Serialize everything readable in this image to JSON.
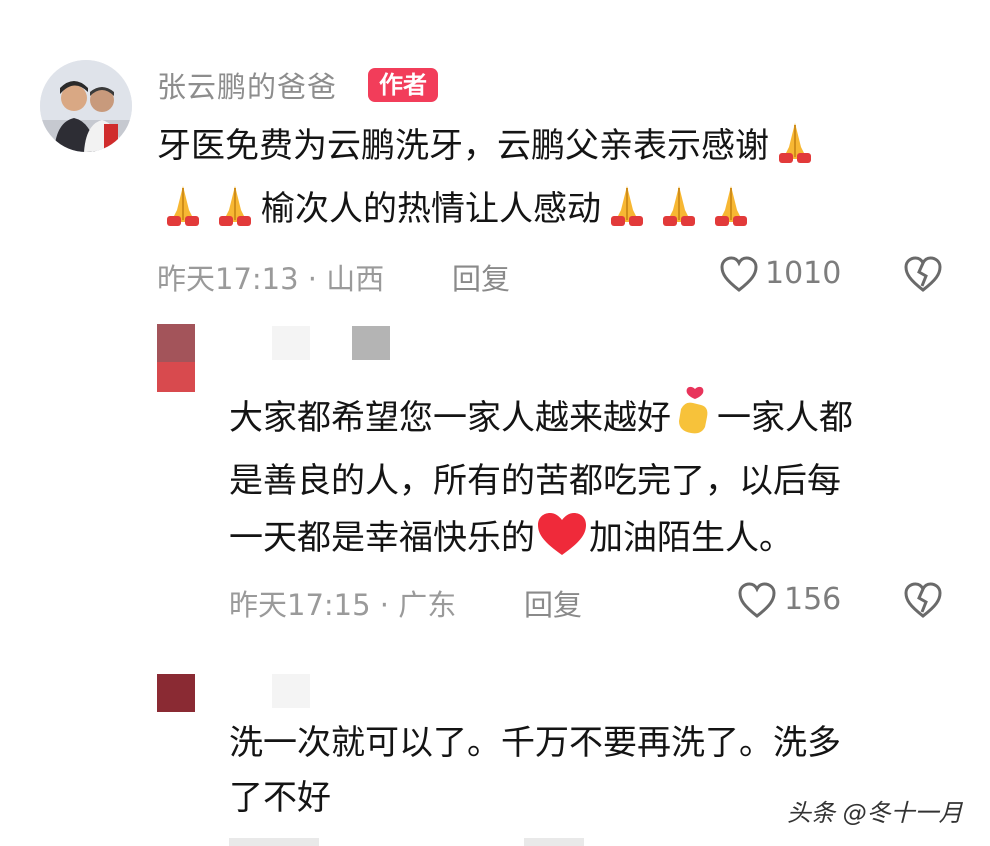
{
  "comment1": {
    "username": "张云鹏的爸爸",
    "badge": "作者",
    "line1": "牙医免费为云鹏洗牙，云鹏父亲表示感谢",
    "line2": "榆次人的热情让人感动",
    "time": "昨天17:13",
    "separator": "·",
    "region": "山西",
    "reply": "回复",
    "likes": "1010"
  },
  "comment2": {
    "line1a": "大家都希望您一家人越来越好",
    "line1b": "一家人都",
    "line2": "是善良的人，所有的苦都吃完了，以后每",
    "line3a": "一天都是幸福快乐的",
    "line3b": "加油陌生人。",
    "time": "昨天17:15",
    "separator": "·",
    "region": "广东",
    "reply": "回复",
    "likes": "156"
  },
  "comment3": {
    "line1": "洗一次就可以了。千万不要再洗了。洗多",
    "line2": "了不好"
  },
  "watermark": "头条 @冬十一月",
  "icons": {
    "pray": "folded-hands-emoji",
    "finger_heart": "finger-heart-emoji",
    "heart": "red-heart-emoji",
    "like": "heart-outline-icon",
    "dislike": "broken-heart-outline-icon"
  }
}
